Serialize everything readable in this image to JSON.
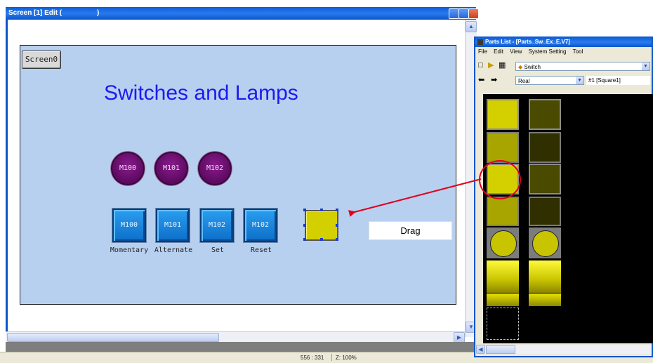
{
  "editor": {
    "title": "Screen [1] Edit (",
    "title_suffix": ")",
    "screen_button": "Screen0",
    "heading": "Switches and Lamps",
    "lamps": [
      "M100",
      "M101",
      "M102"
    ],
    "switches": [
      {
        "label": "M100",
        "caption": "Momentary"
      },
      {
        "label": "M101",
        "caption": "Alternate"
      },
      {
        "label": "M102",
        "caption": "Set"
      },
      {
        "label": "M102",
        "caption": "Reset"
      }
    ],
    "drag_label": "Drag"
  },
  "status_bar": {
    "coords": "556 : 331",
    "zoom": "Z: 100%"
  },
  "parts_list": {
    "title": "Parts List - [Parts_Sw_Ex_E.V7]",
    "menu": [
      "File",
      "Edit",
      "View",
      "System Setting",
      "Tool"
    ],
    "category": "Switch",
    "style": "Real",
    "part": "#1 [Square1]"
  },
  "colors": {
    "canvas": "#b8d0ef",
    "heading": "#1b1bf0",
    "lamp": "#6e1070",
    "switch": "#1a86dd",
    "highlight": "#e0001c",
    "part_yellow": "#d4d000"
  }
}
